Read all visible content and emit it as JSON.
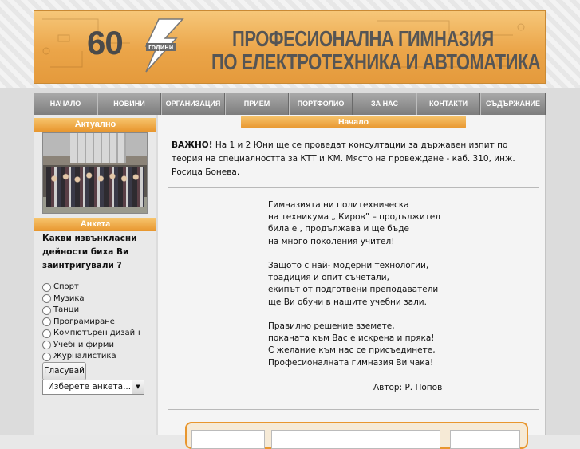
{
  "banner": {
    "number": "60",
    "years_label": "години",
    "title_line1": "ПРОФЕСИОНАЛНА ГИМНАЗИЯ",
    "title_line2": "ПО ЕЛЕКТРОТЕХНИКА И АВТОМАТИКА"
  },
  "nav": {
    "items": [
      {
        "label": "НАЧАЛО"
      },
      {
        "label": "НОВИНИ"
      },
      {
        "label": "ОРГАНИЗАЦИЯ"
      },
      {
        "label": "ПРИЕМ"
      },
      {
        "label": "ПОРТФОЛИО"
      },
      {
        "label": "ЗА НАС"
      },
      {
        "label": "КОНТАКТИ"
      },
      {
        "label": "СЪДЪРЖАНИЕ"
      }
    ]
  },
  "sidebar": {
    "news_title": "Актуално",
    "poll_title": "Анкета",
    "poll_question": "Какви извънкласни дейности биха Ви заинтригували ?",
    "options": [
      {
        "label": "Спорт"
      },
      {
        "label": "Музика"
      },
      {
        "label": "Танци"
      },
      {
        "label": "Програмиране"
      },
      {
        "label": "Компютърен дизайн"
      },
      {
        "label": "Учебни фирми"
      },
      {
        "label": "Журналистика"
      }
    ],
    "vote_label": "Гласувай",
    "select_value": "Изберете анкета..."
  },
  "main": {
    "title": "Начало",
    "announce_bold": "ВАЖНО!",
    "announce_text": " На 1 и 2 Юни ще се проведат консултации за държавен изпит по теория на специалността за КТТ и КМ. Място на провеждане - каб. 310, инж. Росица Бонева.",
    "poem": [
      [
        "Гимназията ни политехническа",
        "на техникума „ Киров” – продължител",
        "била е , продължава и ще бъде",
        "на много поколения учител!"
      ],
      [
        "Защото с най- модерни технологии,",
        "традиция и опит съчетали,",
        "екипът от подготвени преподаватели",
        "ще Ви обучи в нашите учебни зали."
      ],
      [
        "Правилно решение вземете,",
        "поканата към Вас е искрена и пряка!",
        "С желание към нас се присъединете,",
        "Професионалната гимназия Ви чака!"
      ]
    ],
    "author": "Автор: Р. Попов"
  },
  "colors": {
    "accent_orange": "#e8962e",
    "nav_gray": "#8d8d8d"
  }
}
